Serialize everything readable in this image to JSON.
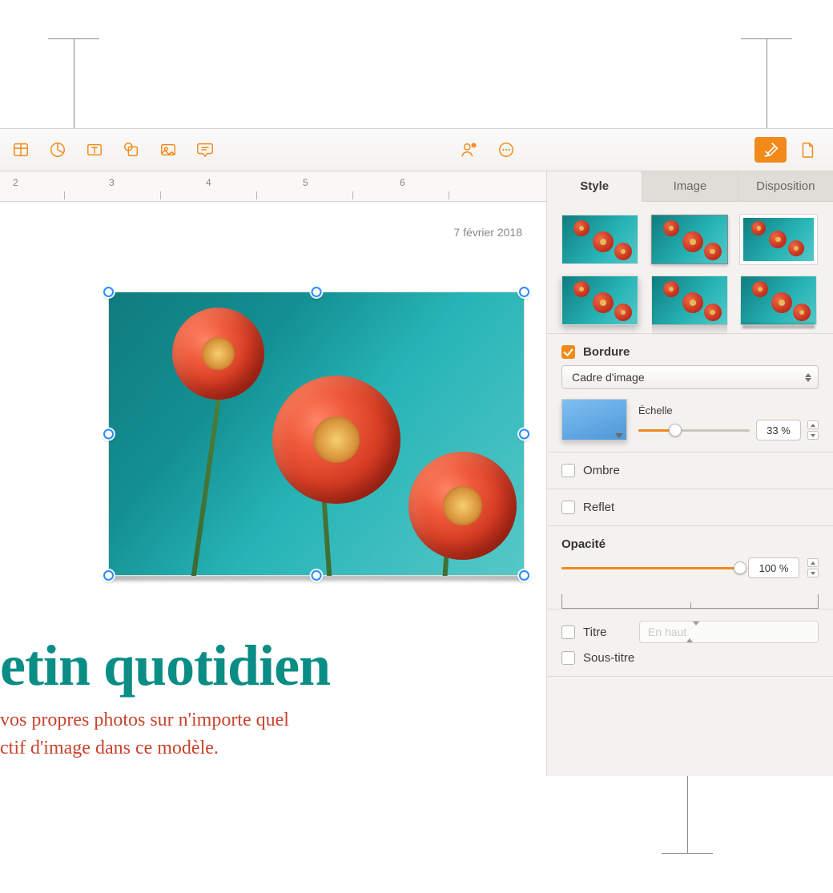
{
  "ruler": {
    "marks": [
      "2",
      "3",
      "4",
      "5",
      "6"
    ]
  },
  "document": {
    "date": "7 février 2018",
    "headline": "etin quotidien",
    "subhead_line1": " vos propres photos sur n'importe quel",
    "subhead_line2": "ctif d'image dans ce modèle."
  },
  "sidebar": {
    "tabs": {
      "style": "Style",
      "image": "Image",
      "layout": "Disposition"
    },
    "border": {
      "label": "Bordure",
      "dropdown": "Cadre d'image",
      "scale_label": "Échelle",
      "scale_value": "33 %"
    },
    "shadow": {
      "label": "Ombre"
    },
    "reflect": {
      "label": "Reflet"
    },
    "opacity": {
      "label": "Opacité",
      "value": "100 %"
    },
    "caption": {
      "title_label": "Titre",
      "title_position": "En haut",
      "subtitle_label": "Sous-titre"
    }
  }
}
